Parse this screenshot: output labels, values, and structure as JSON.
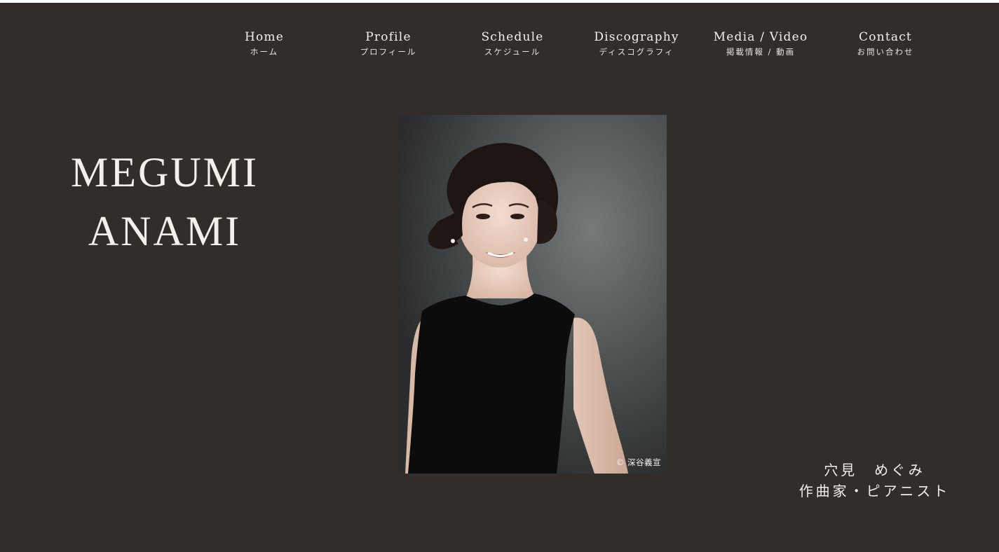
{
  "nav": {
    "items": [
      {
        "en": "Home",
        "ja": "ホーム"
      },
      {
        "en": "Profile",
        "ja": "プロフィール"
      },
      {
        "en": "Schedule",
        "ja": "スケジュール"
      },
      {
        "en": "Discography",
        "ja": "ディスコグラフィ"
      },
      {
        "en": "Media / Video",
        "ja": "掲載情報 / 動画"
      },
      {
        "en": "Contact",
        "ja": "お問い合わせ"
      }
    ]
  },
  "hero": {
    "name_line1": "MEGUMI",
    "name_line2": "ANAMI",
    "photo_credit": "© 深谷義宣",
    "subtitle_name": "穴見　めぐみ",
    "subtitle_role": "作曲家・ピアニスト"
  },
  "colors": {
    "background": "#322d2a",
    "text": "#f2efe9",
    "top_strip": "#ffffff"
  }
}
